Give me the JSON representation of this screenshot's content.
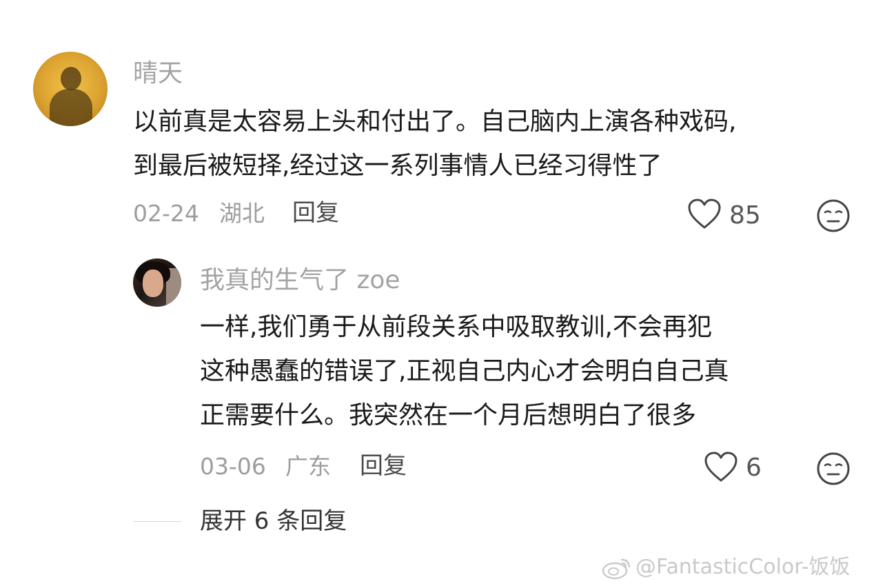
{
  "comment": {
    "username": "晴天",
    "content_lines": [
      "以前真是太容易上头和付出了。自己脑内上演各种戏码,",
      "到最后被短择,经过这一系列事情人已经习得性了"
    ],
    "date": "02-24",
    "location": "湖北",
    "reply_label": "回复",
    "like_count": "85",
    "icons": {
      "avatar": "avatar",
      "like": "heart-icon",
      "dislike": "neutral-face-icon"
    }
  },
  "reply": {
    "username": "我真的生气了 zoe",
    "content_lines": [
      "一样,我们勇于从前段关系中吸取教训,不会再犯",
      "这种愚蠢的错误了,正视自己内心才会明白自己真",
      "正需要什么。我突然在一个月后想明白了很多"
    ],
    "date": "03-06",
    "location": "广东",
    "reply_label": "回复",
    "like_count": "6",
    "icons": {
      "avatar": "avatar",
      "like": "heart-icon",
      "dislike": "neutral-face-icon"
    }
  },
  "expand_replies_label": "展开 6 条回复",
  "watermark": "@FantasticColor-饭饭",
  "colors": {
    "username": "#a3a3a3",
    "text": "#1a1a1a",
    "meta": "#9d9d9d",
    "icon": "#444444"
  }
}
